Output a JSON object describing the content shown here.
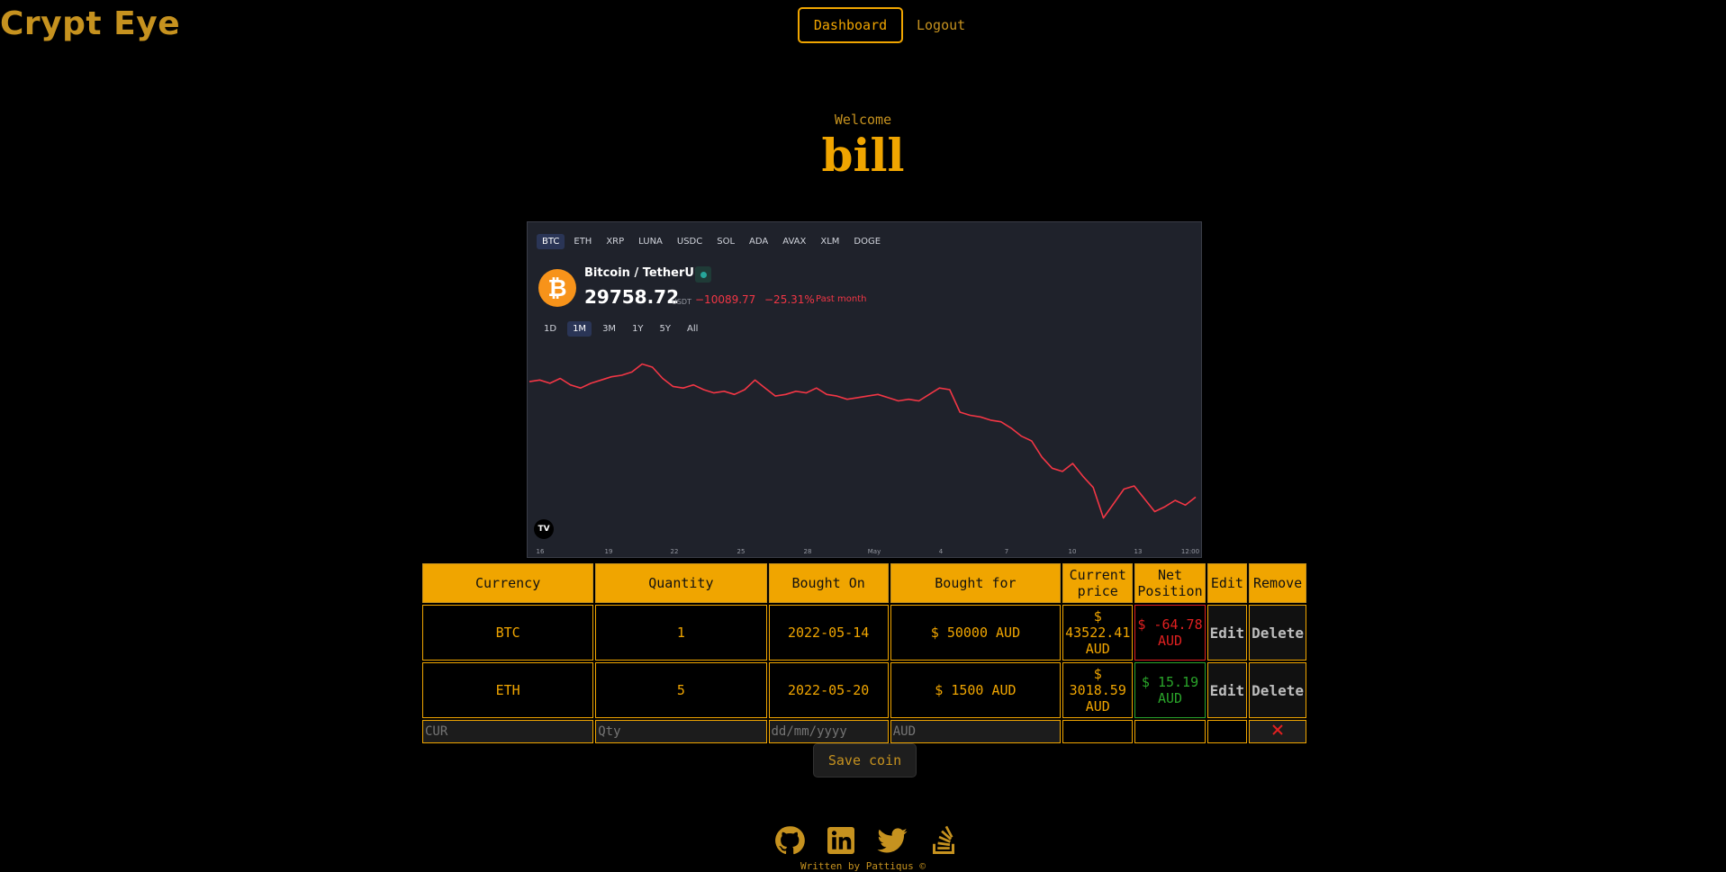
{
  "brand": "Crypt Eye",
  "nav": {
    "dashboard": "Dashboard",
    "logout": "Logout"
  },
  "welcome": {
    "label": "Welcome",
    "username": "bill"
  },
  "widget": {
    "symbols": [
      "BTC",
      "ETH",
      "XRP",
      "LUNA",
      "USDC",
      "SOL",
      "ADA",
      "AVAX",
      "XLM",
      "DOGE"
    ],
    "active_symbol": "BTC",
    "pair": "Bitcoin / TetherUS",
    "coin_icon": "bitcoin-icon",
    "price": "29758.72",
    "price_unit": "USDT",
    "change": "−10089.77",
    "change_pct": "−25.31%",
    "period_label": "Past month",
    "ranges": [
      "1D",
      "1M",
      "3M",
      "1Y",
      "5Y",
      "All"
    ],
    "active_range": "1M",
    "tv_logo": "TV",
    "line_color": "#f23645",
    "background": "#1f222b",
    "chart_data": {
      "type": "line",
      "x_tick_labels": [
        "16",
        "19",
        "22",
        "25",
        "28",
        "May",
        "4",
        "7",
        "10",
        "13",
        "12:00"
      ],
      "series": [
        {
          "values": [
            39700,
            39800,
            39600,
            39900,
            39500,
            39300,
            39600,
            39800,
            40000,
            40100,
            40300,
            40800,
            40600,
            39900,
            39400,
            39300,
            39500,
            39200,
            39000,
            39100,
            38900,
            39200,
            39800,
            39300,
            38800,
            38900,
            39100,
            39000,
            39300,
            38900,
            38800,
            38600,
            38700,
            38800,
            38900,
            38700,
            38500,
            38600,
            38500,
            38900,
            39300,
            39200,
            37800,
            37600,
            37500,
            37300,
            37200,
            36800,
            36300,
            36000,
            35000,
            34300,
            34100,
            34600,
            33800,
            33100,
            31200,
            32100,
            33000,
            33200,
            32400,
            31600,
            31900,
            32300,
            32000,
            32500
          ]
        }
      ],
      "ylim": [
        30000,
        41500
      ]
    }
  },
  "table": {
    "headers": [
      "Currency",
      "Quantity",
      "Bought On",
      "Bought for",
      "Current price",
      "Net Position",
      "Edit",
      "Remove"
    ],
    "rows": [
      {
        "currency": "BTC",
        "quantity": "1",
        "bought_on": "2022-05-14",
        "bought_for": "$ 50000 AUD",
        "current_price": "$ 43522.41 AUD",
        "net_position": "$ -64.78 AUD",
        "edit": "Edit",
        "remove": "Delete"
      },
      {
        "currency": "ETH",
        "quantity": "5",
        "bought_on": "2022-05-20",
        "bought_for": "$ 1500 AUD",
        "current_price": "$ 3018.59 AUD",
        "net_position": "$ 15.19 AUD",
        "edit": "Edit",
        "remove": "Delete"
      }
    ],
    "input_row": {
      "currency_placeholder": "CUR",
      "quantity_placeholder": "Qty",
      "date_placeholder": "dd/mm/yyyy",
      "price_placeholder": "AUD",
      "close_icon": "close-icon"
    }
  },
  "save_button": "Save coin",
  "footer": {
    "icons": [
      "github-icon",
      "linkedin-icon",
      "twitter-icon",
      "stackoverflow-icon"
    ],
    "credit": "Written by Pattiqus ©"
  }
}
